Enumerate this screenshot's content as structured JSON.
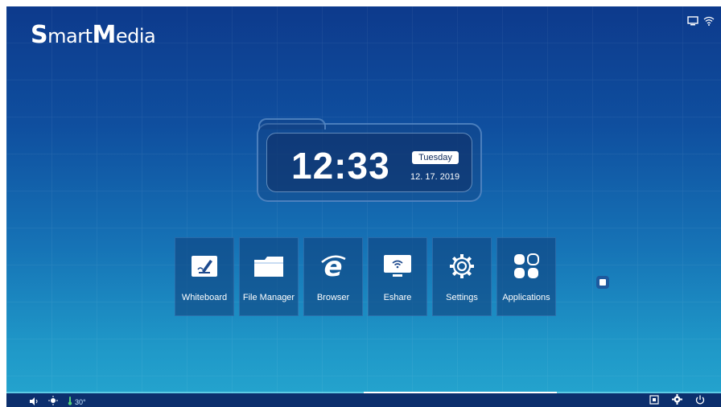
{
  "logo": {
    "first_letter": "S",
    "first_rest": "mart",
    "second_letter": "M",
    "second_rest": "edia"
  },
  "clock": {
    "time": "12:33",
    "day": "Tuesday",
    "date": "12. 17. 2019"
  },
  "apps": [
    {
      "label": "Whiteboard",
      "icon": "whiteboard-icon"
    },
    {
      "label": "File Manager",
      "icon": "folder-icon"
    },
    {
      "label": "Browser",
      "icon": "browser-e-icon"
    },
    {
      "label": "Eshare",
      "icon": "eshare-icon"
    },
    {
      "label": "Settings",
      "icon": "gear-icon"
    },
    {
      "label": "Applications",
      "icon": "apps-grid-icon"
    }
  ],
  "status_bar": {
    "temperature": "30°"
  },
  "colors": {
    "background_top": "#0d3a8c",
    "background_bottom": "#25a6cf",
    "accent": "#7fdcf0",
    "bottom_bar": "#0c2f6d"
  }
}
